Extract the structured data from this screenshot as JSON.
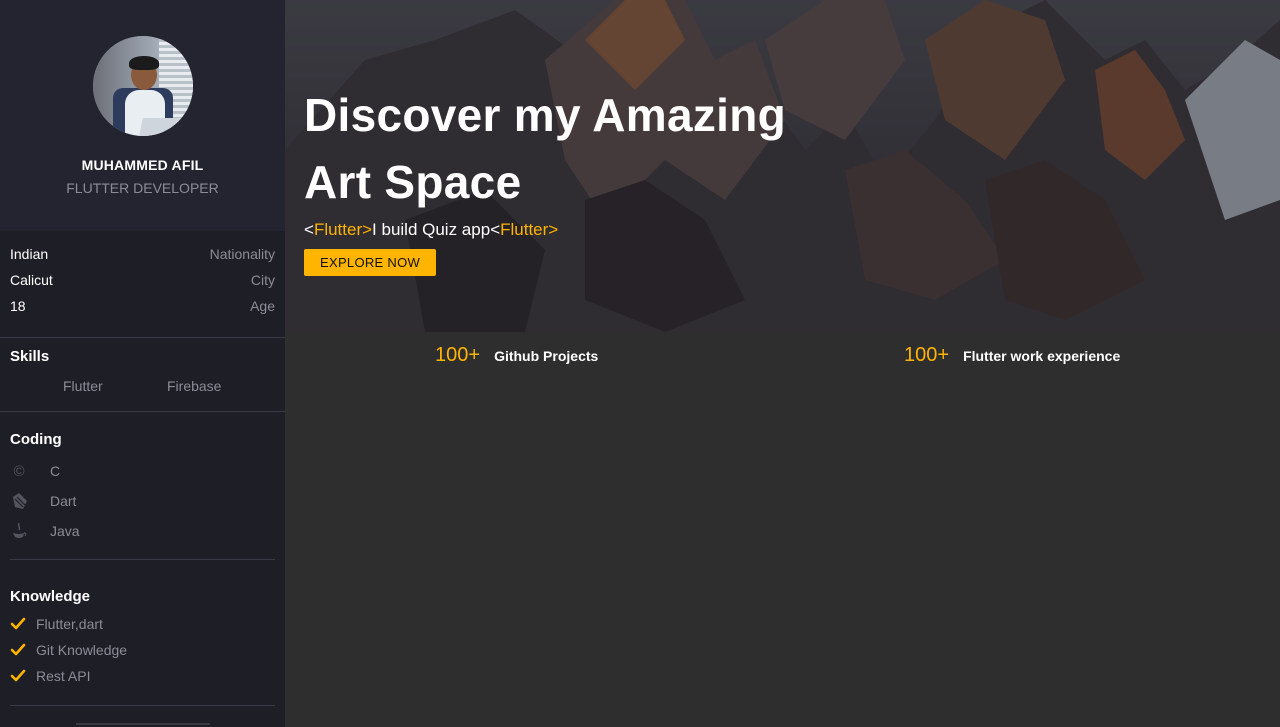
{
  "profile": {
    "name": "MUHAMMED AFIL",
    "role": "FLUTTER DEVELOPER"
  },
  "info": [
    {
      "value": "Indian",
      "label": "Nationality"
    },
    {
      "value": "Calicut",
      "label": "City"
    },
    {
      "value": "18",
      "label": "Age"
    }
  ],
  "skills": {
    "title": "Skills",
    "items": [
      "Flutter",
      "Firebase"
    ]
  },
  "coding": {
    "title": "Coding",
    "items": [
      {
        "label": "C",
        "icon": "copyright-c-icon"
      },
      {
        "label": "Dart",
        "icon": "dart-icon"
      },
      {
        "label": "Java",
        "icon": "java-coffee-icon"
      }
    ]
  },
  "knowledge": {
    "title": "Knowledge",
    "items": [
      "Flutter,dart",
      "Git Knowledge",
      "Rest API"
    ]
  },
  "hero": {
    "title": "Discover my Amazing Art Space",
    "sub_open": "<",
    "sub_tag1": "Flutter>",
    "sub_text": "I build Quiz app",
    "sub_open2": "<",
    "sub_tag2": "Flutter>",
    "button": "EXPLORE NOW"
  },
  "stats": [
    {
      "number": "100+",
      "label": "Github Projects"
    },
    {
      "number": "100+",
      "label": "Flutter work experience"
    }
  ],
  "colors": {
    "accent": "#ffb400",
    "sidebar": "#1e1e26",
    "profile_bg": "#242430",
    "content_bg": "#2e2e2e"
  }
}
